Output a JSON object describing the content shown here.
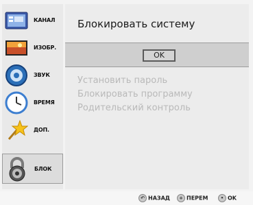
{
  "sidebar": {
    "items": [
      {
        "label": "КАНАЛ",
        "icon": "tv-channel-icon"
      },
      {
        "label": "ИЗОБР.",
        "icon": "picture-icon"
      },
      {
        "label": "ЗВУК",
        "icon": "speaker-icon"
      },
      {
        "label": "ВРЕМЯ",
        "icon": "clock-icon"
      },
      {
        "label": "ДОП.",
        "icon": "star-wand-icon"
      },
      {
        "label": "БЛОК",
        "icon": "padlock-icon",
        "active": true
      }
    ]
  },
  "main": {
    "title": "Блокировать систему",
    "ok_label": "OK",
    "options": [
      "Установить пароль",
      "Блокировать программу",
      "Родительский контроль"
    ]
  },
  "footer": {
    "hints": [
      {
        "icon": "back-key-icon",
        "label": "НАЗАД"
      },
      {
        "icon": "move-key-icon",
        "label": "ПЕРЕМ"
      },
      {
        "icon": "ok-key-icon",
        "label": "OK"
      }
    ]
  },
  "colors": {
    "sidebar_bg": "#e9e9e9",
    "main_bg": "#ececec",
    "band_bg": "#cfcfcf",
    "disabled_text": "#b9b9b9"
  }
}
